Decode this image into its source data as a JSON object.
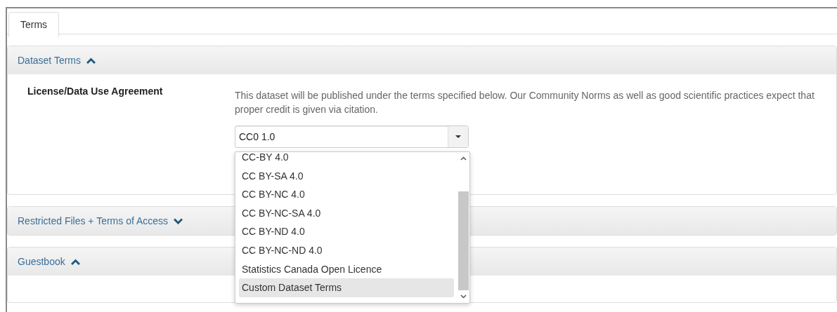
{
  "tabs": [
    {
      "label": "Terms",
      "selected": true
    }
  ],
  "panels": [
    {
      "title": "Dataset Terms",
      "expanded": true,
      "field_label": "License/Data Use Agreement",
      "help_text": "This dataset will be published under the terms specified below. Our Community Norms as well as good scientific practices expect that proper credit is given via citation.",
      "select": {
        "value": "CC0 1.0",
        "options": [
          {
            "label": "CC-BY 4.0",
            "selected": false
          },
          {
            "label": "CC BY-SA 4.0",
            "selected": false
          },
          {
            "label": "CC BY-NC 4.0",
            "selected": false
          },
          {
            "label": "CC BY-NC-SA 4.0",
            "selected": false
          },
          {
            "label": "CC BY-ND 4.0",
            "selected": false
          },
          {
            "label": "CC BY-NC-ND 4.0",
            "selected": false
          },
          {
            "label": "Statistics Canada Open Licence",
            "selected": false
          },
          {
            "label": "Custom Dataset Terms",
            "selected": true
          }
        ]
      }
    },
    {
      "title": "Restricted Files + Terms of Access",
      "expanded": false
    },
    {
      "title": "Guestbook",
      "expanded": true
    }
  ]
}
